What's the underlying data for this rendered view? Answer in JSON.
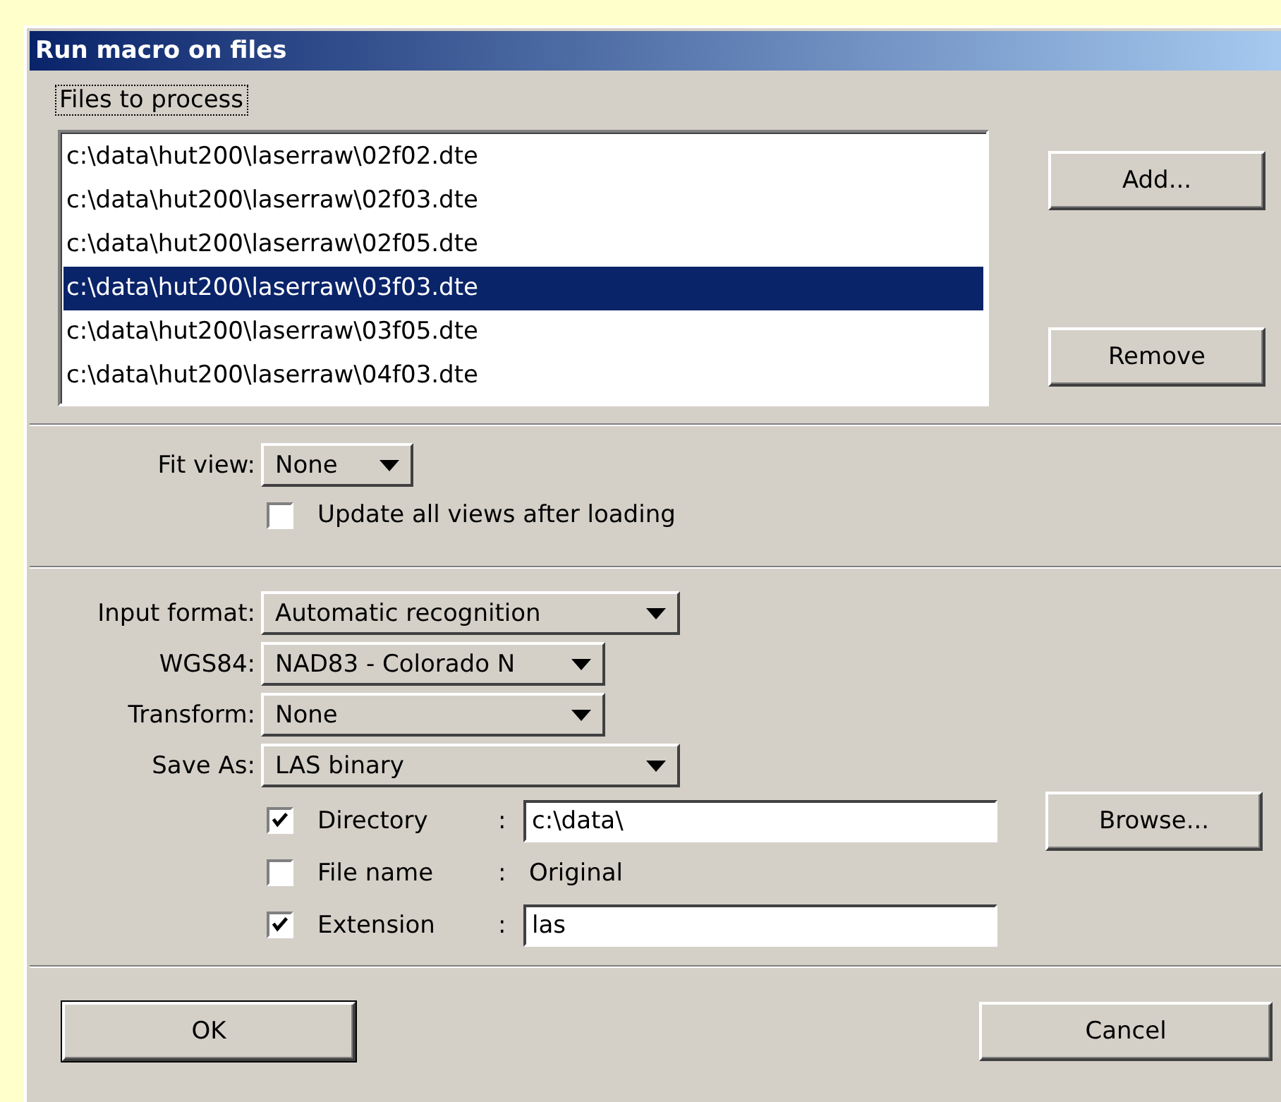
{
  "window": {
    "title": "Run macro on files"
  },
  "files": {
    "label": "Files to process",
    "items": [
      {
        "path": "c:\\data\\hut200\\laserraw\\02f02.dte",
        "selected": false
      },
      {
        "path": "c:\\data\\hut200\\laserraw\\02f03.dte",
        "selected": false
      },
      {
        "path": "c:\\data\\hut200\\laserraw\\02f05.dte",
        "selected": false
      },
      {
        "path": "c:\\data\\hut200\\laserraw\\03f03.dte",
        "selected": true
      },
      {
        "path": "c:\\data\\hut200\\laserraw\\03f05.dte",
        "selected": false
      },
      {
        "path": "c:\\data\\hut200\\laserraw\\04f03.dte",
        "selected": false
      }
    ]
  },
  "file_buttons": [
    {
      "label": "Add..."
    },
    {
      "label": "Remove"
    }
  ],
  "fit_view": {
    "label": "Fit view:",
    "value": "None"
  },
  "update_views": {
    "label": "Update all views after loading",
    "checked": false
  },
  "format_rows": [
    {
      "label": "Input format:",
      "value": "Automatic recognition"
    },
    {
      "label": "WGS84:",
      "value": "NAD83 - Colorado N"
    },
    {
      "label": "Transform:",
      "value": "None"
    },
    {
      "label": "Save As:",
      "value": "LAS binary"
    }
  ],
  "output_options": [
    {
      "kind": "field",
      "label": "Directory",
      "checked": true,
      "separator": ":",
      "value": "c:\\data\\"
    },
    {
      "kind": "text",
      "label": "File name",
      "checked": false,
      "separator": ":",
      "value": "Original"
    },
    {
      "kind": "field",
      "label": "Extension",
      "checked": true,
      "separator": ":",
      "value": "las"
    }
  ],
  "browse_button": "Browse...",
  "footer_buttons": [
    {
      "label": "OK",
      "default": true
    },
    {
      "label": "Cancel",
      "default": false
    }
  ]
}
